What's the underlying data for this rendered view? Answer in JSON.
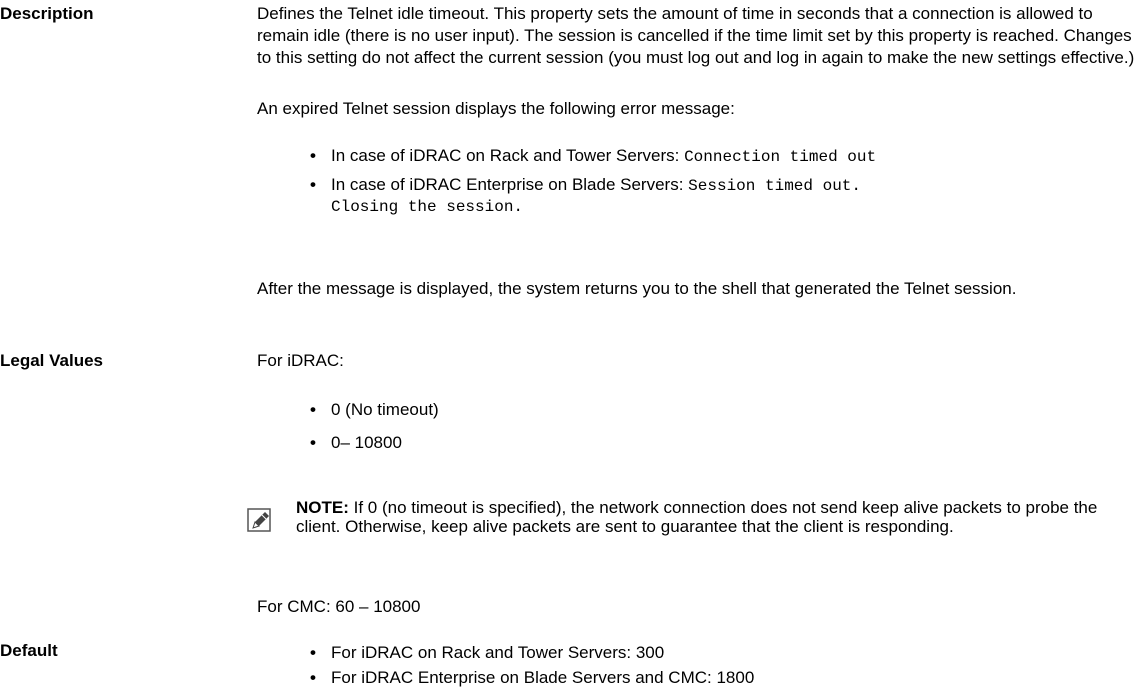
{
  "description": {
    "label": "Description",
    "para1": "Defines the Telnet idle timeout. This property sets the amount of time in seconds that a connection is allowed to remain idle (there is no user input). The session is cancelled if the time limit set by this property is reached. Changes to this setting do not affect the current session (you must log out and log in again to make the new settings effective.)",
    "para2": "An expired Telnet session displays the following error message:",
    "bullets": [
      {
        "prefix": "In case of iDRAC on Rack and Tower Servers: ",
        "code": "Connection timed out"
      },
      {
        "prefix": "In case of iDRAC Enterprise on Blade Servers: ",
        "code_line1": "Session timed out.",
        "code_line2": "Closing the session."
      }
    ],
    "para3": "After the message is displayed, the system returns you to the shell that generated the Telnet session."
  },
  "legal_values": {
    "label": "Legal Values",
    "intro": "For iDRAC:",
    "bullets": [
      "0 (No timeout)",
      "0– 10800"
    ],
    "note_label": "NOTE:",
    "note_text": " If 0 (no timeout is specified), the network connection does not send keep alive packets to probe the client. Otherwise, keep alive packets are sent to guarantee that the client is responding.",
    "note_icon": "pencil-icon",
    "cmc": "For CMC: 60 – 10800"
  },
  "default": {
    "label": "Default",
    "bullets": [
      "For iDRAC on Rack and Tower Servers: 300",
      "For iDRAC Enterprise on Blade Servers and CMC: 1800"
    ]
  }
}
